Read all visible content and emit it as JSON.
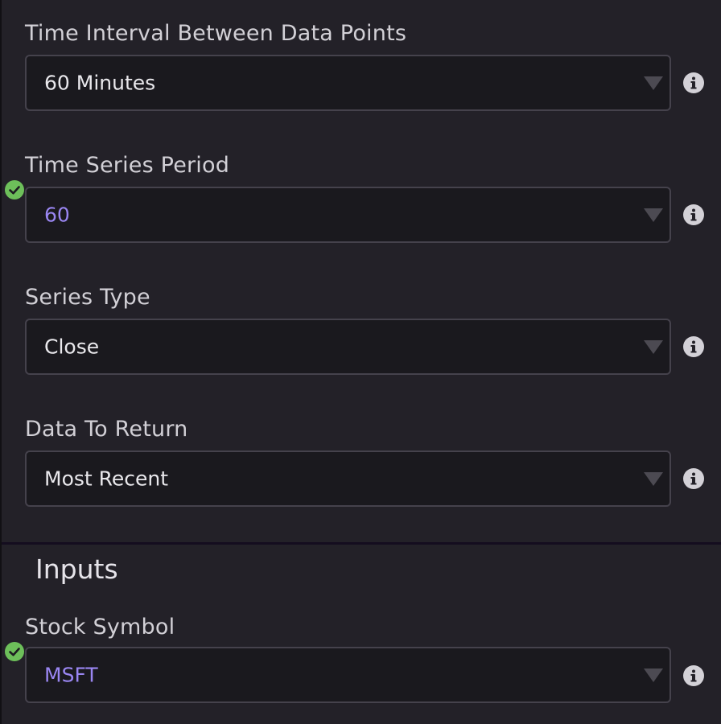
{
  "fields": [
    {
      "label": "Time Interval Between Data Points",
      "value": "60 Minutes",
      "linked": false
    },
    {
      "label": "Time Series Period",
      "value": "60",
      "linked": true
    },
    {
      "label": "Series Type",
      "value": "Close",
      "linked": false
    },
    {
      "label": "Data To Return",
      "value": "Most Recent",
      "linked": false
    }
  ],
  "inputs_section": {
    "title": "Inputs",
    "fields": [
      {
        "label": "Stock Symbol",
        "value": "MSFT",
        "linked": true
      }
    ]
  },
  "icons": {
    "dropdown": "chevron-down-icon",
    "info": "info-icon",
    "linked_status": "check-circle-icon"
  },
  "colors": {
    "background": "#232128",
    "select_background": "#1a191e",
    "linked_value": "#9a86f2",
    "check": "#6dbf5a"
  }
}
